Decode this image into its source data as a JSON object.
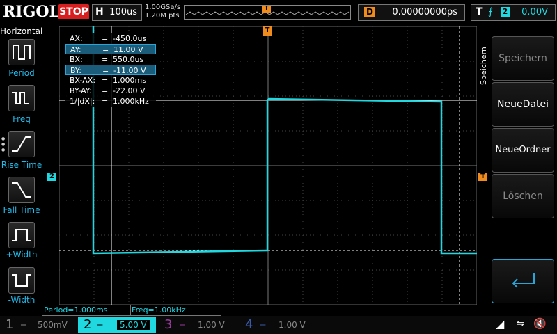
{
  "topbar": {
    "logo": "RIGOL",
    "run_state": "STOP",
    "horizontal_label": "H",
    "timebase": "100us",
    "sample_rate": "1.00GSa/s",
    "memory_depth": "1.20M pts",
    "trigger_marker": "T",
    "delay_label": "D",
    "delay_value": "0.00000000ps",
    "trigger_label": "T",
    "trigger_source": "2",
    "trigger_level": "0.00V"
  },
  "left_panel": {
    "title": "Horizontal",
    "items": [
      {
        "label": "Period"
      },
      {
        "label": "Freq"
      },
      {
        "label": "Rise Time"
      },
      {
        "label": "Fall Time"
      },
      {
        "label": "+Width"
      },
      {
        "label": "-Width"
      }
    ]
  },
  "cursor_info": {
    "rows": [
      {
        "key": "AX:",
        "value": "-450.0us"
      },
      {
        "key": "AY:",
        "value": "11.00 V"
      },
      {
        "key": "BX:",
        "value": "550.0us"
      },
      {
        "key": "BY:",
        "value": "-11.00 V"
      },
      {
        "key": "BX-AX:",
        "value": "1.000ms"
      },
      {
        "key": "BY-AY:",
        "value": "-22.00 V"
      },
      {
        "key": "1/|dX|:",
        "value": "1.000kHz"
      }
    ],
    "eq": "="
  },
  "measurements": {
    "period": "Period=1.000ms",
    "freq": "Freq=1.00kHz"
  },
  "right_panel": {
    "menu_title": "Speichern",
    "buttons": [
      {
        "label": "Speichern",
        "enabled": false
      },
      {
        "label": "NeueDatei",
        "enabled": true
      },
      {
        "label": "NeueOrdner",
        "enabled": true
      },
      {
        "label": "Löschen",
        "enabled": false
      }
    ]
  },
  "channels": [
    {
      "num": "1",
      "scale": "500mV",
      "color": "#888888",
      "active": false
    },
    {
      "num": "2",
      "scale": "5.00 V",
      "color": "#1fd8e0",
      "active": true
    },
    {
      "num": "3",
      "scale": "1.00 V",
      "color": "#9b3aa0",
      "active": false
    },
    {
      "num": "4",
      "scale": "1.00 V",
      "color": "#3a5aa8",
      "active": false
    }
  ],
  "markers": {
    "ch2_ground": "2",
    "trigger_level_marker": "T"
  },
  "colors": {
    "trace": "#1fd8e0",
    "accent_orange": "#f08c1e",
    "grid": "#555555",
    "stop_red": "#d81e1e"
  }
}
